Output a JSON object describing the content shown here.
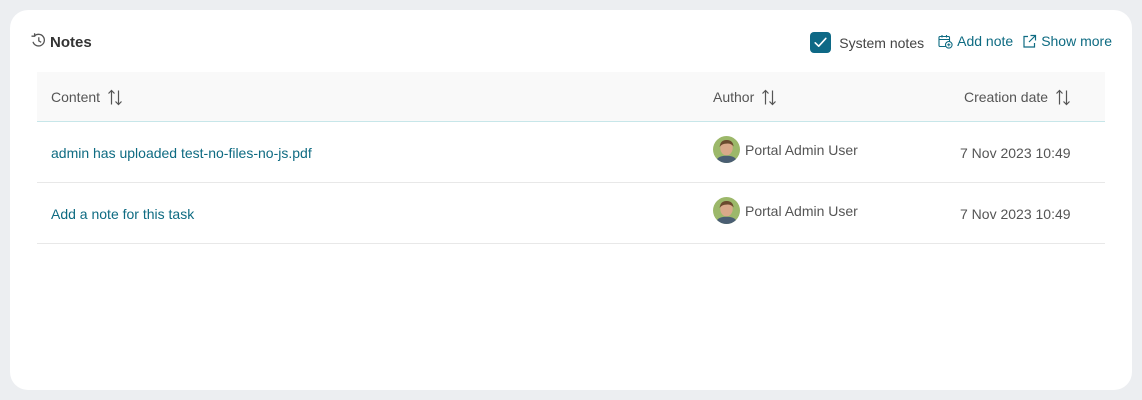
{
  "panel": {
    "title": "Notes",
    "icons": {
      "title": "history-icon",
      "checkbox": "check-icon",
      "add": "calendar-add-icon",
      "more": "external-link-icon",
      "sort": "sort-icon"
    }
  },
  "toolbar": {
    "system_notes_label": "System notes",
    "system_notes_checked": true,
    "add_note_label": "Add note",
    "show_more_label": "Show more"
  },
  "table": {
    "columns": {
      "content": "Content",
      "author": "Author",
      "creation_date": "Creation date"
    },
    "rows": [
      {
        "content": "admin has uploaded test-no-files-no-js.pdf",
        "author": "Portal Admin User",
        "date": "7 Nov 2023 10:49"
      },
      {
        "content": "Add a note for this task",
        "author": "Portal Admin User",
        "date": "7 Nov 2023 10:49"
      }
    ]
  },
  "colors": {
    "accent": "#0e6986",
    "link": "#0e6b82",
    "background": "#eceef1"
  }
}
